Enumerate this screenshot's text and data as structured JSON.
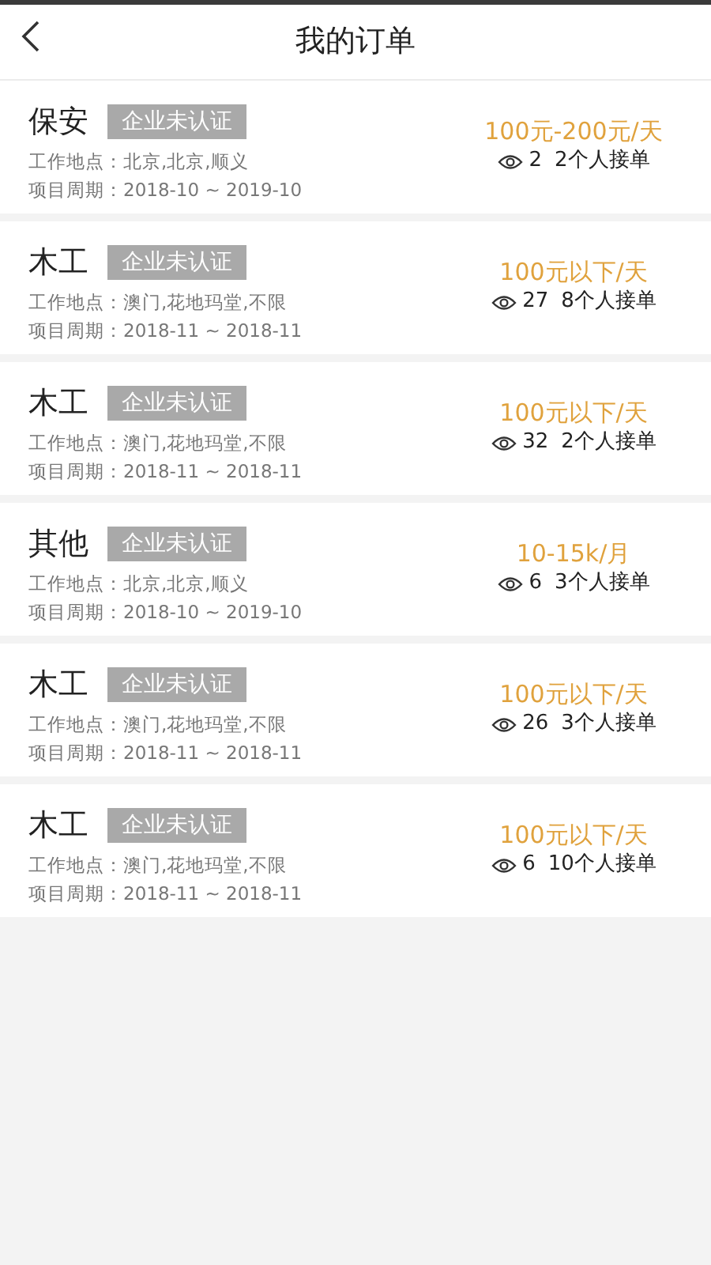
{
  "header": {
    "title": "我的订单"
  },
  "orders": [
    {
      "title": "保安",
      "tag": "企业未认证",
      "location": "工作地点：北京,北京,顺义",
      "period": "项目周期：2018-10 ~ 2019-10",
      "price": "100元-200元/天",
      "views": "2",
      "applicants": "2个人接单"
    },
    {
      "title": "木工",
      "tag": "企业未认证",
      "location": "工作地点：澳门,花地玛堂,不限",
      "period": "项目周期：2018-11 ~ 2018-11",
      "price": "100元以下/天",
      "views": "27",
      "applicants": "8个人接单"
    },
    {
      "title": "木工",
      "tag": "企业未认证",
      "location": "工作地点：澳门,花地玛堂,不限",
      "period": "项目周期：2018-11 ~ 2018-11",
      "price": "100元以下/天",
      "views": "32",
      "applicants": "2个人接单"
    },
    {
      "title": "其他",
      "tag": "企业未认证",
      "location": "工作地点：北京,北京,顺义",
      "period": "项目周期：2018-10 ~ 2019-10",
      "price": "10-15k/月",
      "views": "6",
      "applicants": "3个人接单"
    },
    {
      "title": "木工",
      "tag": "企业未认证",
      "location": "工作地点：澳门,花地玛堂,不限",
      "period": "项目周期：2018-11 ~ 2018-11",
      "price": "100元以下/天",
      "views": "26",
      "applicants": "3个人接单"
    },
    {
      "title": "木工",
      "tag": "企业未认证",
      "location": "工作地点：澳门,花地玛堂,不限",
      "period": "项目周期：2018-11 ~ 2018-11",
      "price": "100元以下/天",
      "views": "6",
      "applicants": "10个人接单"
    }
  ]
}
